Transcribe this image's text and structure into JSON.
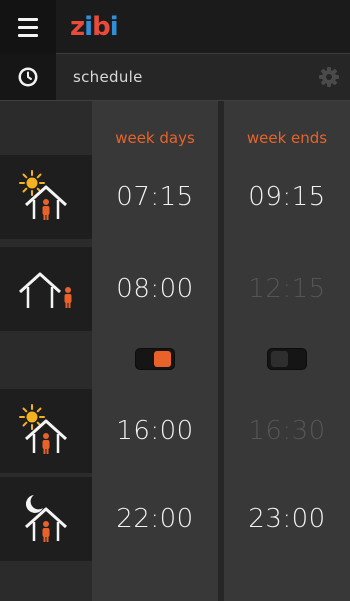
{
  "header": {
    "logo_parts": [
      "z",
      "i",
      "b",
      "i"
    ],
    "subtitle": "schedule"
  },
  "columns": {
    "weekdays_label": "week days",
    "weekends_label": "week ends"
  },
  "rows": [
    {
      "icon": "sun-home-person-icon",
      "weekdays": "07:15",
      "weekends": "09:15",
      "weekends_active": true
    },
    {
      "icon": "person-away-icon",
      "weekdays": "08:00",
      "weekends": "12:15",
      "weekends_active": false
    },
    {
      "icon": "sun-home-person-icon",
      "weekdays": "16:00",
      "weekends": "16:30",
      "weekends_active": false
    },
    {
      "icon": "moon-home-person-icon",
      "weekdays": "22:00",
      "weekends": "23:00",
      "weekends_active": true
    }
  ],
  "toggles": {
    "weekdays_enabled": true,
    "weekends_enabled": false
  },
  "colors": {
    "accent": "#e8622a",
    "sun": "#f5b21e",
    "logo_red": "#e84b3a",
    "logo_blue": "#2f8fd8"
  }
}
